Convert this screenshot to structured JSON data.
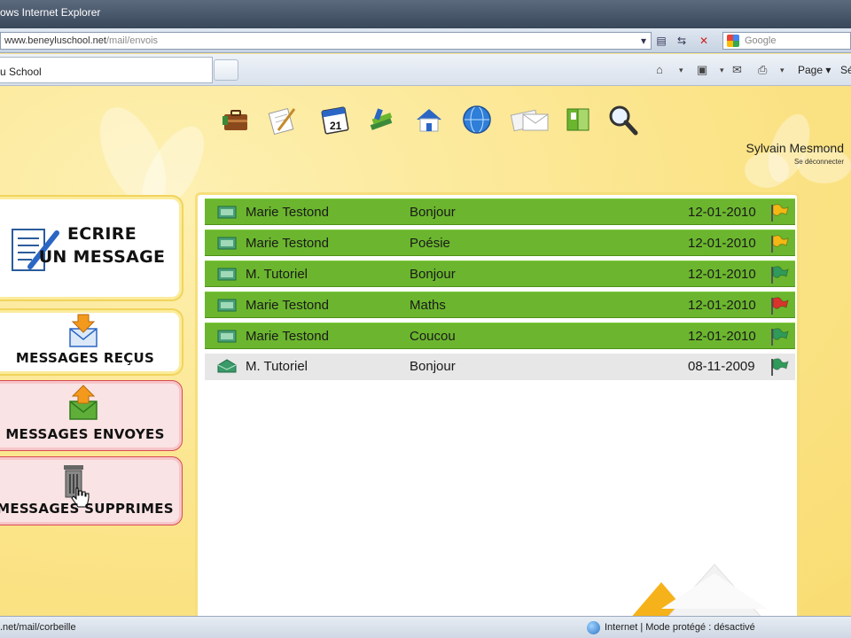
{
  "browser": {
    "title": "ows Internet Explorer",
    "url_host": "www.beneyluschool.net",
    "url_path": "/mail/envois",
    "search_placeholder": "Google",
    "tab_title": "u School",
    "page_menu": "Page ▾",
    "security_menu": "Sé"
  },
  "header": {
    "user_name": "Sylvain Mesmond",
    "logout": "Se déconnecter",
    "apps": [
      {
        "name": "briefcase-icon"
      },
      {
        "name": "notepad-icon"
      },
      {
        "name": "calendar-icon",
        "label": "21"
      },
      {
        "name": "books-icon"
      },
      {
        "name": "home-icon"
      },
      {
        "name": "globe-icon"
      },
      {
        "name": "envelopes-icon"
      },
      {
        "name": "album-icon"
      },
      {
        "name": "magnifier-icon"
      }
    ]
  },
  "menu": {
    "write_line1": "ECRIRE",
    "write_line2": "UN MESSAGE",
    "received": "MESSAGES REÇUS",
    "sent": "MESSAGES ENVOYES",
    "deleted": "MESSAGES SUPPRIMES"
  },
  "messages": [
    {
      "from": "Marie Testond",
      "subject": "Bonjour",
      "date": "12-01-2010",
      "flag": "yellow",
      "flag_color": "#f3b813",
      "state": "unread"
    },
    {
      "from": "Marie Testond",
      "subject": "Poésie",
      "date": "12-01-2010",
      "flag": "yellow",
      "flag_color": "#f3b813",
      "state": "unread"
    },
    {
      "from": "M. Tutoriel",
      "subject": "Bonjour",
      "date": "12-01-2010",
      "flag": "green",
      "flag_color": "#2f9a5a",
      "state": "unread"
    },
    {
      "from": "Marie Testond",
      "subject": "Maths",
      "date": "12-01-2010",
      "flag": "red",
      "flag_color": "#d9342b",
      "state": "unread"
    },
    {
      "from": "Marie Testond",
      "subject": "Coucou",
      "date": "12-01-2010",
      "flag": "green",
      "flag_color": "#2f9a5a",
      "state": "unread"
    },
    {
      "from": "M. Tutoriel",
      "subject": "Bonjour",
      "date": "08-11-2009",
      "flag": "green",
      "flag_color": "#2f9a5a",
      "state": "read"
    }
  ],
  "status": {
    "url": ".net/mail/corbeille",
    "zone": "Internet | Mode protégé : désactivé"
  },
  "colors": {
    "unread_row": "#6bb62e",
    "read_row": "#e7e7e7",
    "page_bg": "#fbe68e",
    "active_menu_border": "#d84a54"
  }
}
